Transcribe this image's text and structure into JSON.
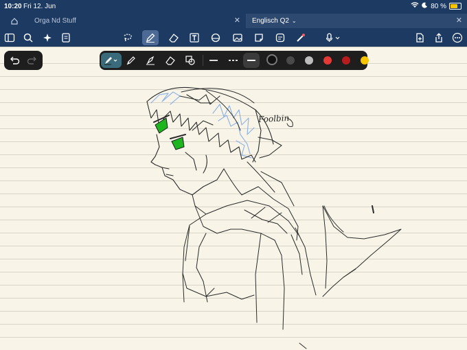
{
  "status_bar": {
    "time": "10:20",
    "date": "Fri 12. Jun",
    "battery": "80 %",
    "battery_level": 0.8
  },
  "tabs": [
    {
      "label": "Orga Nd Stuff",
      "active": false
    },
    {
      "label": "Englisch Q2",
      "active": true
    }
  ],
  "toolbar": {
    "icons": [
      "sidebar-icon",
      "search-icon",
      "sparkle-icon",
      "document-icon",
      "lasso-icon",
      "pencil-icon",
      "eraser-icon",
      "text-icon",
      "shapes-icon",
      "image-icon",
      "sticky-note-icon",
      "laser-icon",
      "microphone-icon",
      "add-page-icon",
      "share-icon",
      "more-icon"
    ]
  },
  "pen_toolbar": {
    "colors": [
      "#111111",
      "#4a4a4a",
      "#bdbdbd",
      "#e53935",
      "#b71c1c",
      "#f6c400"
    ],
    "accent": "#3a6b7a"
  },
  "drawing": {
    "signature": "Foolbin",
    "eye_color": "#1fb51f",
    "hair_highlight": "#7fa9e8"
  }
}
